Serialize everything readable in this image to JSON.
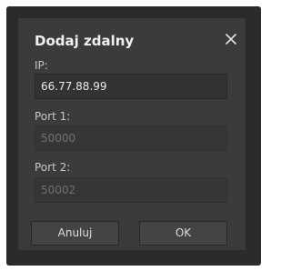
{
  "dialog": {
    "title": "Dodaj zdalny",
    "close_icon": "close-icon",
    "fields": {
      "ip": {
        "label": "IP:",
        "value": "66.77.88.99",
        "enabled": true
      },
      "port1": {
        "label": "Port 1:",
        "value": "50000",
        "enabled": false
      },
      "port2": {
        "label": "Port 2:",
        "value": "50002",
        "enabled": false
      }
    },
    "buttons": {
      "cancel_label": "Anuluj",
      "ok_label": "OK"
    }
  },
  "colors": {
    "frame": "#2b2b2b",
    "dialog_bg": "#3b3b3b",
    "field_bg": "#323232",
    "button_bg": "#444444",
    "text": "#f0f0f0",
    "disabled_text": "#6f6f6f"
  }
}
